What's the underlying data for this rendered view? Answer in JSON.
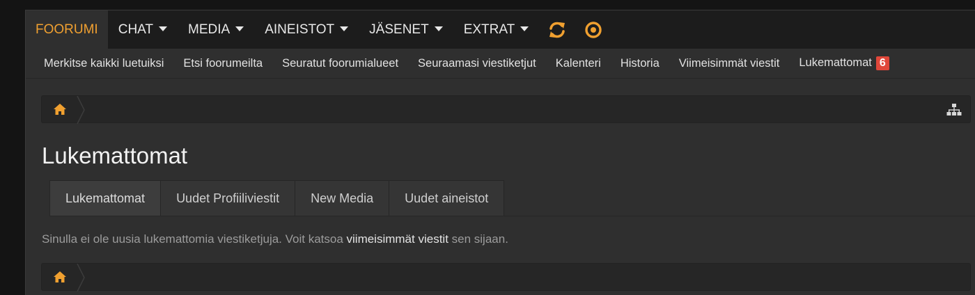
{
  "topnav": {
    "tabs": [
      {
        "label": "FOORUMI",
        "active": true,
        "dropdown": false
      },
      {
        "label": "CHAT",
        "dropdown": true
      },
      {
        "label": "MEDIA",
        "dropdown": true
      },
      {
        "label": "AINEISTOT",
        "dropdown": true
      },
      {
        "label": "JÄSENET",
        "dropdown": true
      },
      {
        "label": "EXTRAT",
        "dropdown": true
      }
    ],
    "icons": [
      "refresh-icon",
      "target-icon"
    ]
  },
  "subnav": {
    "links": [
      "Merkitse kaikki luetuiksi",
      "Etsi foorumeilta",
      "Seuratut foorumialueet",
      "Seuraamasi viestiketjut",
      "Kalenteri",
      "Historia",
      "Viimeisimmät viestit",
      "Lukemattomat"
    ],
    "unread_badge": "6"
  },
  "page": {
    "title": "Lukemattomat",
    "tabs": [
      "Lukemattomat",
      "Uudet Profiiliviestit",
      "New Media",
      "Uudet aineistot"
    ],
    "message_before": "Sinulla ei ole uusia lukemattomia viestiketjuja. Voit katsoa ",
    "message_link": "viimeisimmät viestit",
    "message_after": " sen sijaan."
  },
  "colors": {
    "accent": "#f0a030",
    "badge": "#e0473a",
    "background": "#2f2f2f"
  }
}
